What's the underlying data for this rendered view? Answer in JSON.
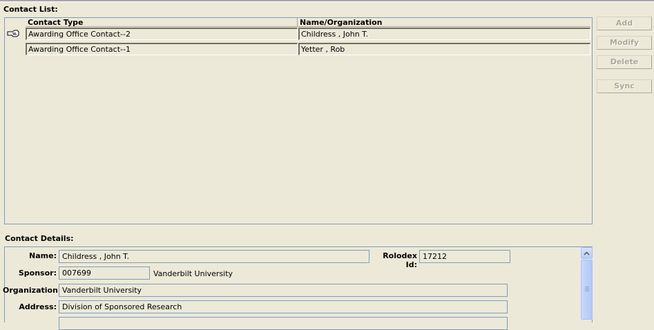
{
  "contact_list": {
    "title": "Contact List:",
    "columns": [
      "Contact Type",
      "Name/Organization"
    ],
    "rows": [
      {
        "type": "Awarding Office Contact--2",
        "name": "Childress ,  John T."
      },
      {
        "type": "Awarding Office Contact--1",
        "name": "Yetter ,  Rob"
      }
    ]
  },
  "buttons": {
    "add": "Add",
    "modify": "Modify",
    "delete": "Delete",
    "sync": "Sync"
  },
  "contact_details": {
    "title": "Contact Details:",
    "name_label": "Name:",
    "name_value": "Childress ,  John T.",
    "rolodex_label": "Rolodex Id:",
    "rolodex_value": "17212",
    "sponsor_label": "Sponsor:",
    "sponsor_code": "007699",
    "sponsor_name": "Vanderbilt University",
    "organization_label": "Organization:",
    "organization_value": "Vanderbilt University",
    "address_label": "Address:",
    "address_value": "Division of Sponsored Research"
  },
  "icons": {
    "row_pointer": "pointing-hand-icon",
    "scroll_up": "scroll-up-arrow-icon"
  }
}
